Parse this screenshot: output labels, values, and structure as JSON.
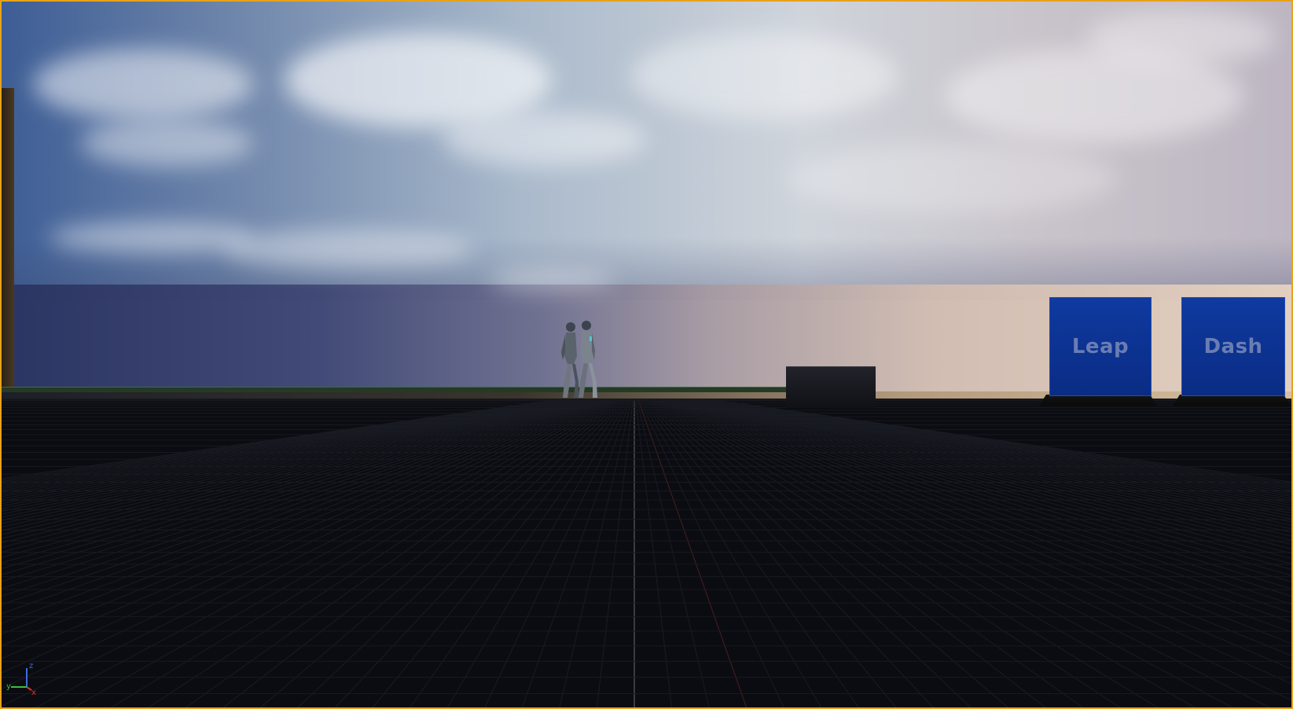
{
  "viewport": {
    "border_color": "#e8a21a",
    "sky_colors": [
      "#3d5d95",
      "#a9b9cb",
      "#e6d2c0"
    ],
    "floor_color": "#0b0c11"
  },
  "scene": {
    "blocks": [
      {
        "label": "Leap",
        "color": "#0a2c84"
      },
      {
        "label": "Dash",
        "color": "#0a2c84"
      }
    ],
    "characters": [
      {
        "name": "mannequin-character-1"
      },
      {
        "name": "mannequin-character-2"
      }
    ]
  },
  "gizmo": {
    "z_label": "z",
    "y_label": "y",
    "x_label": "x",
    "x_color": "#e03030",
    "y_color": "#3cc03c",
    "z_color": "#3a6ee0"
  }
}
